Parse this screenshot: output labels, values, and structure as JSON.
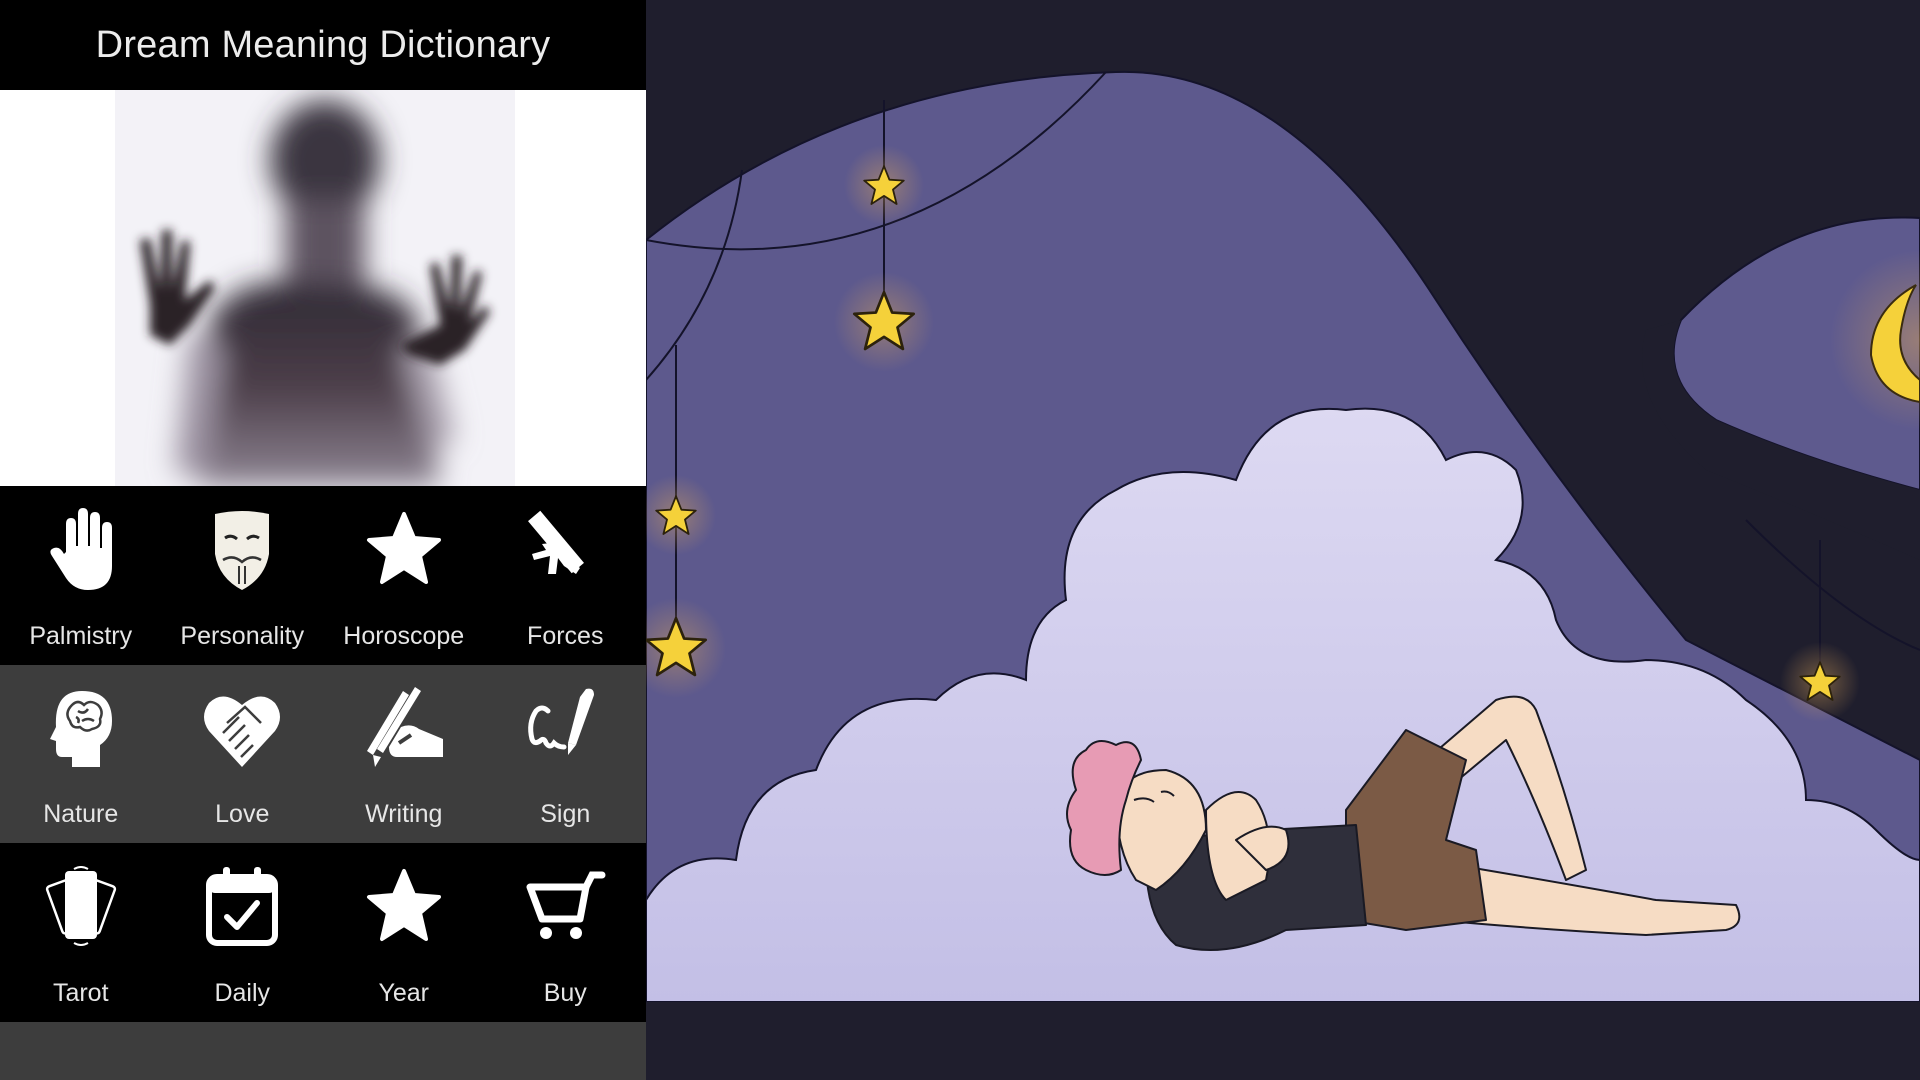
{
  "app": {
    "title": "Dream Meaning Dictionary",
    "hero_image": "blurred-silhouette-behind-glass"
  },
  "grid": [
    [
      {
        "label": "Palmistry",
        "icon": "hand-icon"
      },
      {
        "label": "Personality",
        "icon": "mask-icon"
      },
      {
        "label": "Horoscope",
        "icon": "star-icon"
      },
      {
        "label": "Forces",
        "icon": "falling-beam-icon"
      }
    ],
    [
      {
        "label": "Nature",
        "icon": "brain-head-icon"
      },
      {
        "label": "Love",
        "icon": "heart-handshake-icon"
      },
      {
        "label": "Writing",
        "icon": "hand-pen-icon"
      },
      {
        "label": "Sign",
        "icon": "signature-pen-icon"
      }
    ],
    [
      {
        "label": "Tarot",
        "icon": "tarot-cards-icon"
      },
      {
        "label": "Daily",
        "icon": "calendar-check-icon"
      },
      {
        "label": "Year",
        "icon": "star-icon"
      },
      {
        "label": "Buy",
        "icon": "cart-icon"
      }
    ]
  ],
  "illustration": {
    "subject": "person-sleeping-on-cloud-under-night-sky",
    "colors": {
      "night": "#1f1e2d",
      "sky": "#5e5a8e",
      "cloud": "#c4c0e6",
      "star": "#f5d13a",
      "hair": "#e79bb4",
      "skin": "#f6dcc4",
      "shirt": "#2f2f3b",
      "shorts": "#7b5a45"
    }
  }
}
